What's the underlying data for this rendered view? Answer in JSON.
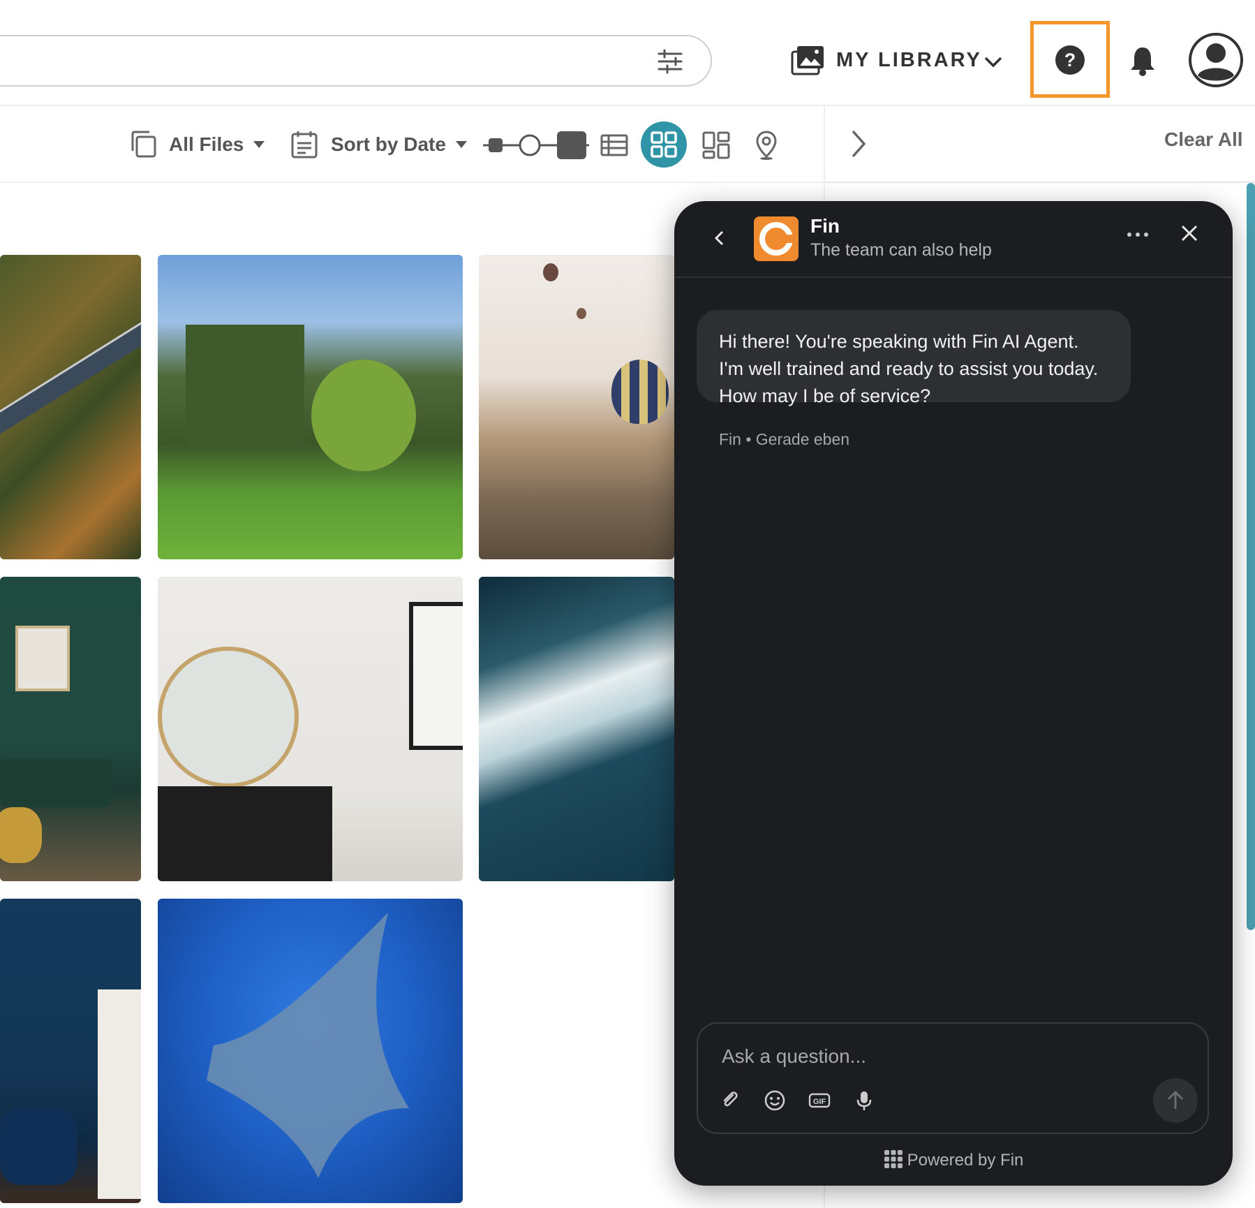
{
  "header": {
    "library_label": "MY LIBRARY"
  },
  "toolbar": {
    "all_files_label": "All Files",
    "sort_label": "Sort by Date",
    "clear_all_label": "Clear All"
  },
  "grid": {
    "photos": [
      {
        "name": "photo-aerial-forest-road"
      },
      {
        "name": "photo-ivy-castle"
      },
      {
        "name": "photo-hot-air-balloons"
      },
      {
        "name": "photo-green-living-room"
      },
      {
        "name": "photo-round-mirror-room"
      },
      {
        "name": "photo-ocean-waves"
      },
      {
        "name": "photo-blue-fireplace-room"
      },
      {
        "name": "photo-manta-ray"
      }
    ]
  },
  "chat": {
    "agent_name": "Fin",
    "subtitle": "The team can also help",
    "message": "Hi there! You're speaking with Fin AI Agent. I'm well trained and ready to assist you today. How may I be of service?",
    "meta": "Fin • Gerade eben",
    "input_placeholder": "Ask a question...",
    "powered_by": "Powered by Fin"
  },
  "colors": {
    "accent_orange": "#f5962b",
    "active_view_teal": "#2e94a6",
    "chat_bg": "#1c1d20"
  }
}
